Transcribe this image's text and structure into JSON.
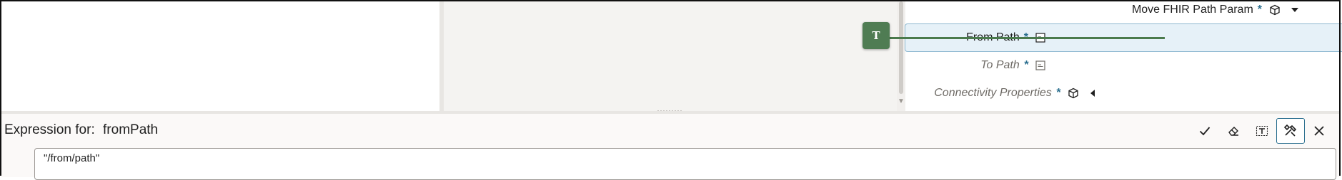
{
  "target_tree": {
    "nodes": [
      {
        "label": "Move FHIR Path Param",
        "required": "*",
        "icon": "cube-icon",
        "trail": "caret-down-icon",
        "style": "normal"
      },
      {
        "label": "From Path",
        "required": "*",
        "icon": "text-field-icon",
        "style": "selected"
      },
      {
        "label": "To Path",
        "required": "*",
        "icon": "text-field-icon",
        "style": "italic"
      },
      {
        "label": "Connectivity Properties",
        "required": "*",
        "icon": "cube-icon",
        "trail": "caret-left-icon",
        "style": "italic"
      }
    ]
  },
  "mapping_badge": {
    "label": "T",
    "color": "#4f7c53"
  },
  "expression_editor": {
    "label_prefix": "Expression for:",
    "field_name": "fromPath",
    "value": "\"/from/path\"",
    "toolbar": [
      "check-icon",
      "eraser-icon",
      "text-select-icon",
      "tools-icon",
      "close-icon"
    ]
  },
  "colors": {
    "accent": "#2b6f8f",
    "mapline": "#4a7a4c",
    "selected_row": "#e6f1f8"
  }
}
